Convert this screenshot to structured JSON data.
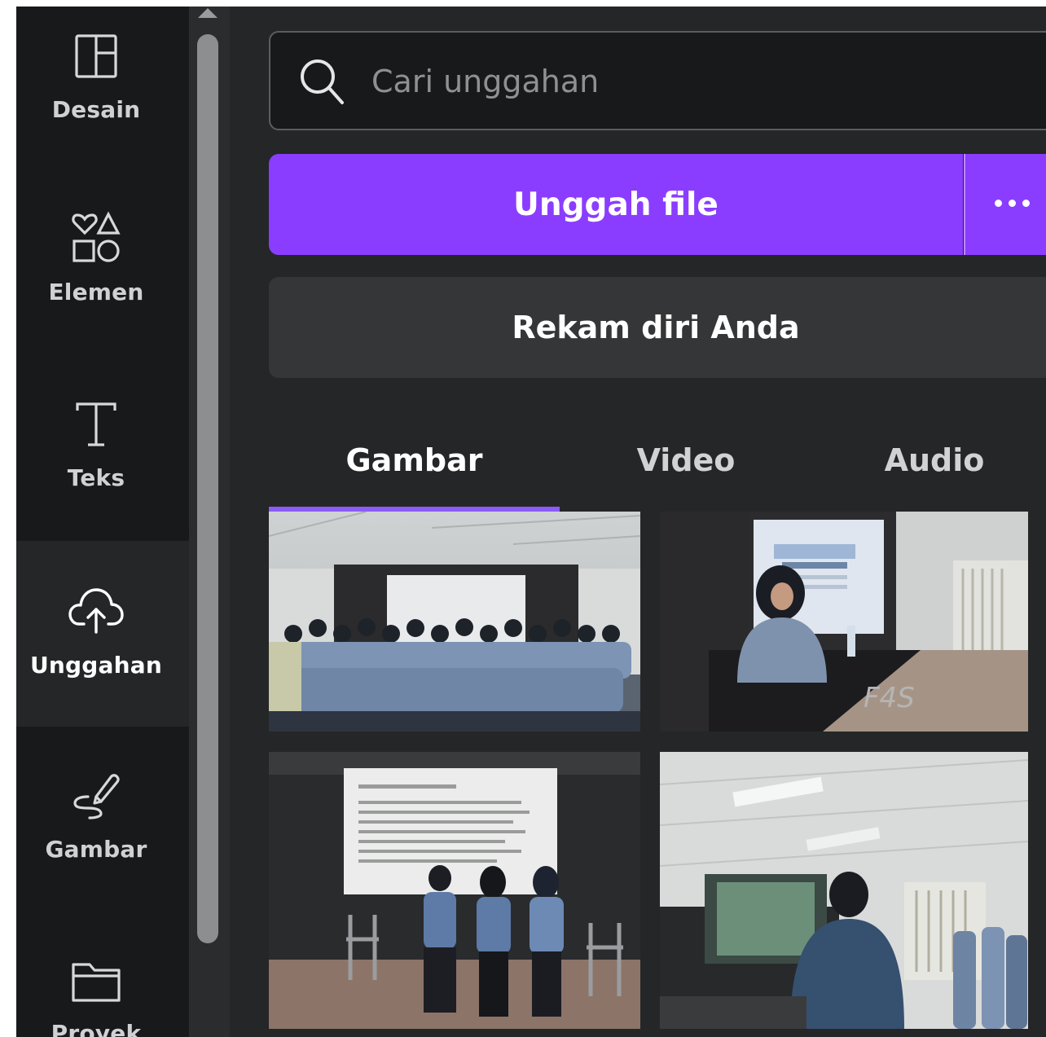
{
  "rail": {
    "items": [
      {
        "label": "Desain",
        "icon": "layout-icon"
      },
      {
        "label": "Elemen",
        "icon": "shapes-icon"
      },
      {
        "label": "Teks",
        "icon": "text-icon"
      },
      {
        "label": "Unggahan",
        "icon": "cloud-upload-icon",
        "active": true
      },
      {
        "label": "Gambar",
        "icon": "draw-icon"
      },
      {
        "label": "Proyek",
        "icon": "folder-icon"
      }
    ]
  },
  "search": {
    "placeholder": "Cari unggahan",
    "value": ""
  },
  "upload": {
    "label": "Unggah file",
    "more_icon": "more-dots-icon"
  },
  "record": {
    "label": "Rekam diri Anda"
  },
  "tabs": [
    {
      "label": "Gambar",
      "active": true
    },
    {
      "label": "Video"
    },
    {
      "label": "Audio"
    }
  ],
  "colors": {
    "accent": "#8b3dff",
    "rail_bg": "#18191b",
    "panel_bg": "#252627"
  },
  "thumbnails": [
    {
      "subject": "group-photo"
    },
    {
      "subject": "speaker-at-podium"
    },
    {
      "subject": "seated-panel"
    },
    {
      "subject": "classroom-presentation"
    }
  ]
}
